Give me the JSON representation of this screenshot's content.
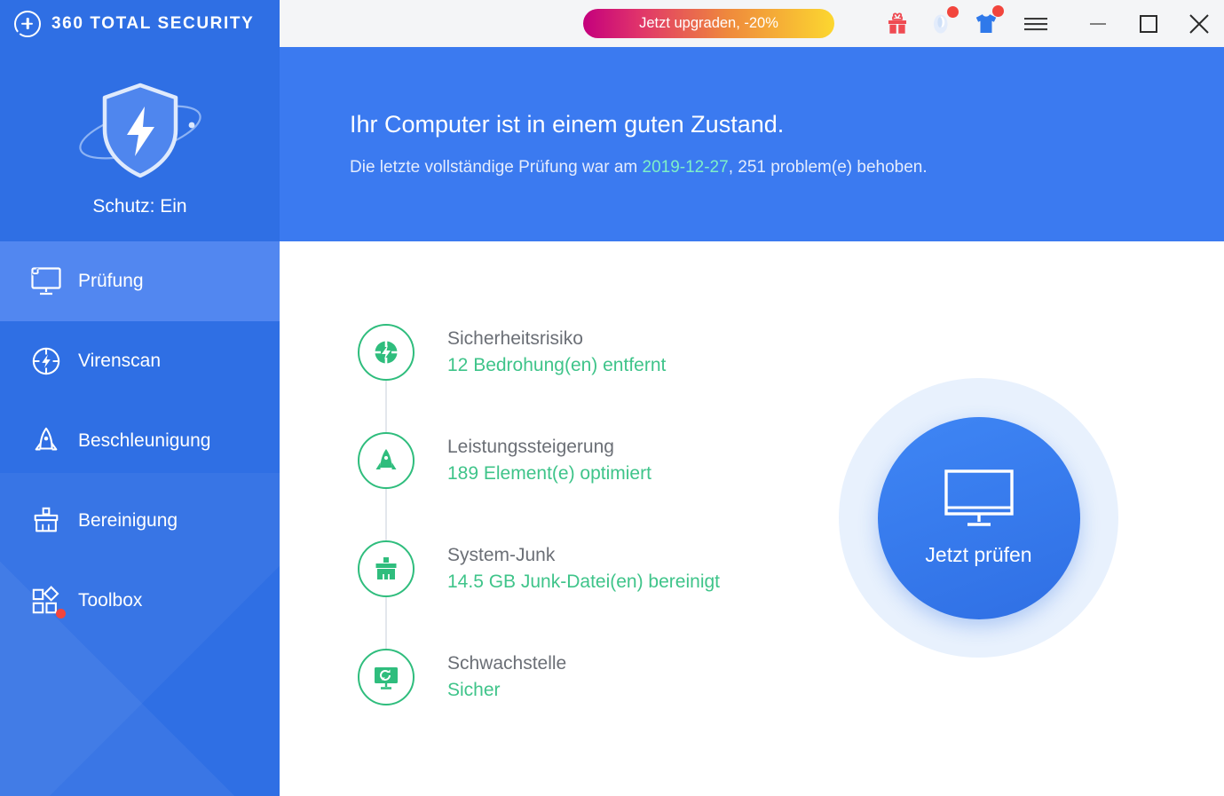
{
  "app": {
    "brand": "360 TOTAL SECURITY",
    "logo_icon": "360-plus-circle-icon"
  },
  "titlebar": {
    "upgrade_label": "Jetzt upgraden, -20%",
    "icons": [
      {
        "name": "gift-icon",
        "badge": false
      },
      {
        "name": "speed-gauge-icon",
        "badge": true
      },
      {
        "name": "tshirt-skin-icon",
        "badge": true
      },
      {
        "name": "hamburger-menu-icon",
        "badge": false
      }
    ],
    "window_controls": {
      "minimize": "minimize-icon",
      "maximize": "maximize-icon",
      "close": "close-icon"
    }
  },
  "sidebar": {
    "shield_icon": "shield-lightning-orbit-icon",
    "protection_status": "Schutz: Ein",
    "items": [
      {
        "label": "Prüfung",
        "icon": "monitor-icon",
        "active": true,
        "badge": false
      },
      {
        "label": "Virenscan",
        "icon": "scan-target-icon",
        "active": false,
        "badge": false
      },
      {
        "label": "Beschleunigung",
        "icon": "rocket-icon",
        "active": false,
        "badge": false
      },
      {
        "label": "Bereinigung",
        "icon": "broom-icon",
        "active": false,
        "badge": false
      },
      {
        "label": "Toolbox",
        "icon": "shapes-grid-icon",
        "active": false,
        "badge": true
      }
    ]
  },
  "banner": {
    "title": "Ihr Computer ist in einem guten Zustand.",
    "sub_before": "Die letzte vollständige Prüfung war am ",
    "date": "2019-12-27",
    "sub_after": ", 251 problem(e) behoben."
  },
  "status_items": [
    {
      "title": "Sicherheitsrisiko",
      "value": "12 Bedrohung(en) entfernt",
      "icon": "shield-scan-icon"
    },
    {
      "title": "Leistungssteigerung",
      "value": "189 Element(e) optimiert",
      "icon": "rocket-icon"
    },
    {
      "title": "System-Junk",
      "value": "14.5 GB Junk-Datei(en) bereinigt",
      "icon": "broom-icon"
    },
    {
      "title": "Schwachstelle",
      "value": "Sicher",
      "icon": "monitor-refresh-icon"
    }
  ],
  "scan_button": {
    "label": "Jetzt prüfen",
    "icon": "monitor-icon"
  },
  "colors": {
    "brand_blue": "#2f6fe4",
    "banner_blue": "#3b7af0",
    "active_nav_blue": "#5287f0",
    "green": "#3fc48a",
    "green_ring": "#2fbd7d",
    "date_green": "#7ef0c8",
    "badge_red": "#f2453d",
    "titlebar_grey": "#f4f5f7",
    "halo_blue": "#e8f1fd"
  }
}
